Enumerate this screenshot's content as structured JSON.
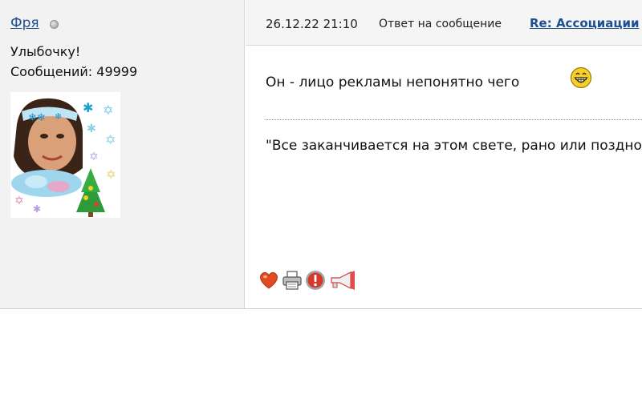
{
  "author": {
    "name": "Фря",
    "title": "Улыбочку!",
    "posts_line": "Сообщений: 49999",
    "status_icon": "offline-status-dot"
  },
  "post": {
    "datetime": "26.12.22 21:10",
    "reply_label": "Ответ на сообщение",
    "reply_link": "Re: Ассоциации",
    "message": "Он - лицо рекламы непонятно чего",
    "smiley": "grin-smiley-icon",
    "signature": "\"Все заканчивается на этом свете, рано или поздно\""
  },
  "actions": [
    {
      "icon": "heart-icon",
      "color": "#e34a1f"
    },
    {
      "icon": "print-icon",
      "color": "#6b6b6b"
    },
    {
      "icon": "warning-icon",
      "color": "#d33a2a"
    },
    {
      "icon": "megaphone-icon",
      "color": "#d44"
    }
  ]
}
